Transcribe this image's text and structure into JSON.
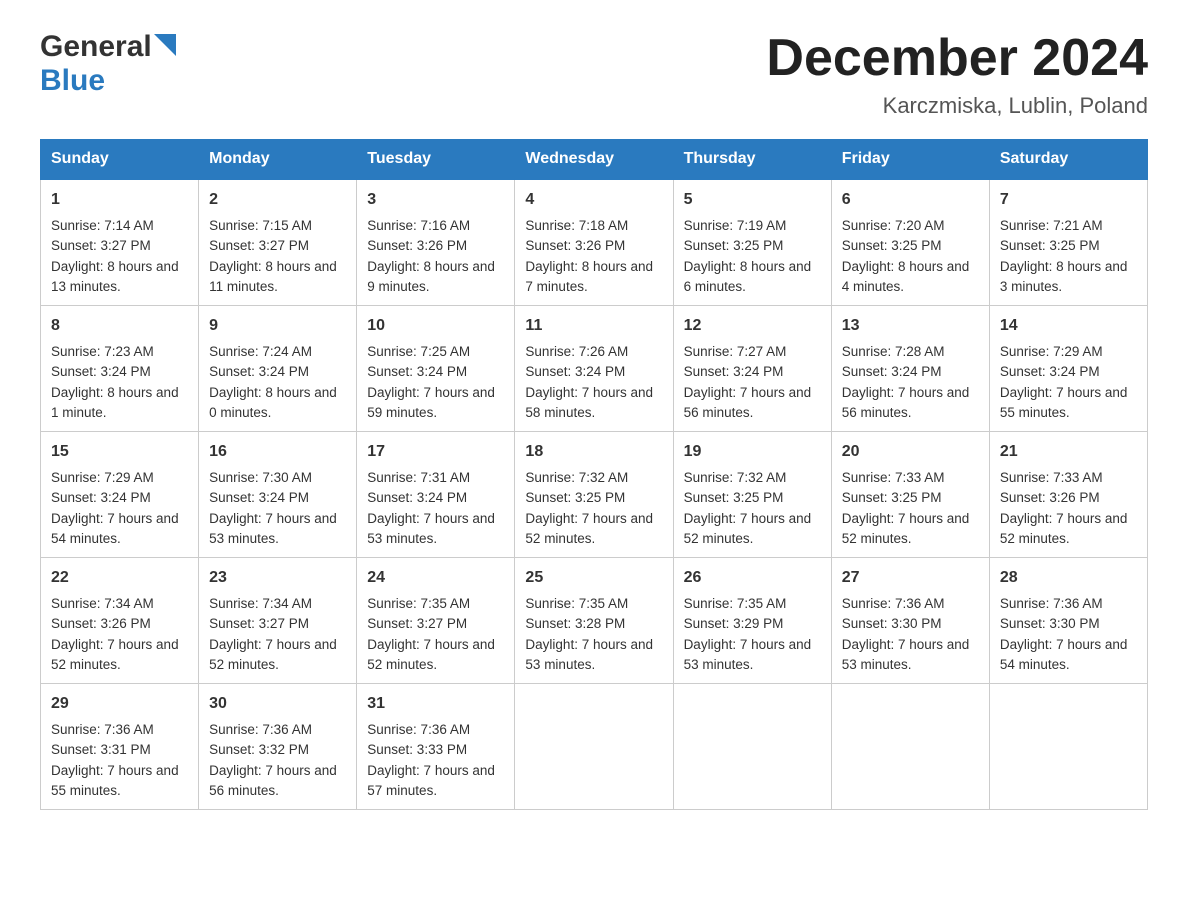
{
  "header": {
    "logo": {
      "text_general": "General",
      "text_blue": "Blue",
      "alt": "GeneralBlue logo"
    },
    "title": "December 2024",
    "subtitle": "Karczmiska, Lublin, Poland"
  },
  "calendar": {
    "days_of_week": [
      "Sunday",
      "Monday",
      "Tuesday",
      "Wednesday",
      "Thursday",
      "Friday",
      "Saturday"
    ],
    "weeks": [
      [
        {
          "day": "1",
          "sunrise": "Sunrise: 7:14 AM",
          "sunset": "Sunset: 3:27 PM",
          "daylight": "Daylight: 8 hours and 13 minutes."
        },
        {
          "day": "2",
          "sunrise": "Sunrise: 7:15 AM",
          "sunset": "Sunset: 3:27 PM",
          "daylight": "Daylight: 8 hours and 11 minutes."
        },
        {
          "day": "3",
          "sunrise": "Sunrise: 7:16 AM",
          "sunset": "Sunset: 3:26 PM",
          "daylight": "Daylight: 8 hours and 9 minutes."
        },
        {
          "day": "4",
          "sunrise": "Sunrise: 7:18 AM",
          "sunset": "Sunset: 3:26 PM",
          "daylight": "Daylight: 8 hours and 7 minutes."
        },
        {
          "day": "5",
          "sunrise": "Sunrise: 7:19 AM",
          "sunset": "Sunset: 3:25 PM",
          "daylight": "Daylight: 8 hours and 6 minutes."
        },
        {
          "day": "6",
          "sunrise": "Sunrise: 7:20 AM",
          "sunset": "Sunset: 3:25 PM",
          "daylight": "Daylight: 8 hours and 4 minutes."
        },
        {
          "day": "7",
          "sunrise": "Sunrise: 7:21 AM",
          "sunset": "Sunset: 3:25 PM",
          "daylight": "Daylight: 8 hours and 3 minutes."
        }
      ],
      [
        {
          "day": "8",
          "sunrise": "Sunrise: 7:23 AM",
          "sunset": "Sunset: 3:24 PM",
          "daylight": "Daylight: 8 hours and 1 minute."
        },
        {
          "day": "9",
          "sunrise": "Sunrise: 7:24 AM",
          "sunset": "Sunset: 3:24 PM",
          "daylight": "Daylight: 8 hours and 0 minutes."
        },
        {
          "day": "10",
          "sunrise": "Sunrise: 7:25 AM",
          "sunset": "Sunset: 3:24 PM",
          "daylight": "Daylight: 7 hours and 59 minutes."
        },
        {
          "day": "11",
          "sunrise": "Sunrise: 7:26 AM",
          "sunset": "Sunset: 3:24 PM",
          "daylight": "Daylight: 7 hours and 58 minutes."
        },
        {
          "day": "12",
          "sunrise": "Sunrise: 7:27 AM",
          "sunset": "Sunset: 3:24 PM",
          "daylight": "Daylight: 7 hours and 56 minutes."
        },
        {
          "day": "13",
          "sunrise": "Sunrise: 7:28 AM",
          "sunset": "Sunset: 3:24 PM",
          "daylight": "Daylight: 7 hours and 56 minutes."
        },
        {
          "day": "14",
          "sunrise": "Sunrise: 7:29 AM",
          "sunset": "Sunset: 3:24 PM",
          "daylight": "Daylight: 7 hours and 55 minutes."
        }
      ],
      [
        {
          "day": "15",
          "sunrise": "Sunrise: 7:29 AM",
          "sunset": "Sunset: 3:24 PM",
          "daylight": "Daylight: 7 hours and 54 minutes."
        },
        {
          "day": "16",
          "sunrise": "Sunrise: 7:30 AM",
          "sunset": "Sunset: 3:24 PM",
          "daylight": "Daylight: 7 hours and 53 minutes."
        },
        {
          "day": "17",
          "sunrise": "Sunrise: 7:31 AM",
          "sunset": "Sunset: 3:24 PM",
          "daylight": "Daylight: 7 hours and 53 minutes."
        },
        {
          "day": "18",
          "sunrise": "Sunrise: 7:32 AM",
          "sunset": "Sunset: 3:25 PM",
          "daylight": "Daylight: 7 hours and 52 minutes."
        },
        {
          "day": "19",
          "sunrise": "Sunrise: 7:32 AM",
          "sunset": "Sunset: 3:25 PM",
          "daylight": "Daylight: 7 hours and 52 minutes."
        },
        {
          "day": "20",
          "sunrise": "Sunrise: 7:33 AM",
          "sunset": "Sunset: 3:25 PM",
          "daylight": "Daylight: 7 hours and 52 minutes."
        },
        {
          "day": "21",
          "sunrise": "Sunrise: 7:33 AM",
          "sunset": "Sunset: 3:26 PM",
          "daylight": "Daylight: 7 hours and 52 minutes."
        }
      ],
      [
        {
          "day": "22",
          "sunrise": "Sunrise: 7:34 AM",
          "sunset": "Sunset: 3:26 PM",
          "daylight": "Daylight: 7 hours and 52 minutes."
        },
        {
          "day": "23",
          "sunrise": "Sunrise: 7:34 AM",
          "sunset": "Sunset: 3:27 PM",
          "daylight": "Daylight: 7 hours and 52 minutes."
        },
        {
          "day": "24",
          "sunrise": "Sunrise: 7:35 AM",
          "sunset": "Sunset: 3:27 PM",
          "daylight": "Daylight: 7 hours and 52 minutes."
        },
        {
          "day": "25",
          "sunrise": "Sunrise: 7:35 AM",
          "sunset": "Sunset: 3:28 PM",
          "daylight": "Daylight: 7 hours and 53 minutes."
        },
        {
          "day": "26",
          "sunrise": "Sunrise: 7:35 AM",
          "sunset": "Sunset: 3:29 PM",
          "daylight": "Daylight: 7 hours and 53 minutes."
        },
        {
          "day": "27",
          "sunrise": "Sunrise: 7:36 AM",
          "sunset": "Sunset: 3:30 PM",
          "daylight": "Daylight: 7 hours and 53 minutes."
        },
        {
          "day": "28",
          "sunrise": "Sunrise: 7:36 AM",
          "sunset": "Sunset: 3:30 PM",
          "daylight": "Daylight: 7 hours and 54 minutes."
        }
      ],
      [
        {
          "day": "29",
          "sunrise": "Sunrise: 7:36 AM",
          "sunset": "Sunset: 3:31 PM",
          "daylight": "Daylight: 7 hours and 55 minutes."
        },
        {
          "day": "30",
          "sunrise": "Sunrise: 7:36 AM",
          "sunset": "Sunset: 3:32 PM",
          "daylight": "Daylight: 7 hours and 56 minutes."
        },
        {
          "day": "31",
          "sunrise": "Sunrise: 7:36 AM",
          "sunset": "Sunset: 3:33 PM",
          "daylight": "Daylight: 7 hours and 57 minutes."
        },
        null,
        null,
        null,
        null
      ]
    ]
  }
}
